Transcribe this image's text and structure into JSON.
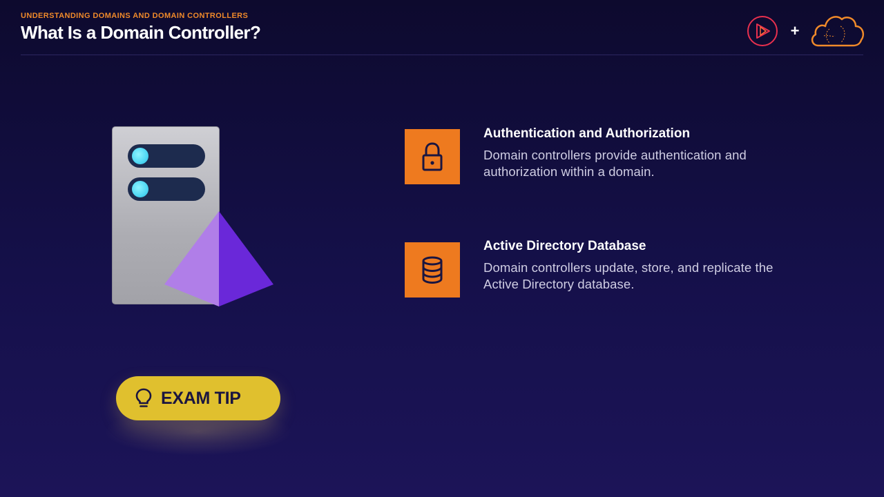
{
  "header": {
    "kicker": "UNDERSTANDING DOMAINS AND DOMAIN CONTROLLERS",
    "title": "What Is a Domain Controller?",
    "plus": "+"
  },
  "features": [
    {
      "icon": "lock-icon",
      "title": "Authentication and Authorization",
      "description": "Domain controllers provide authentication and authorization within a domain."
    },
    {
      "icon": "database-icon",
      "title": "Active Directory Database",
      "description": "Domain controllers update, store, and replicate the Active Directory database."
    }
  ],
  "exam_tip": {
    "label": "EXAM TIP",
    "icon": "lightbulb-icon"
  },
  "colors": {
    "accent_orange": "#ee7a1f",
    "tip_yellow": "#e0c02e",
    "background": "#15104a",
    "pyramid_light": "#b07ee8",
    "pyramid_dark": "#6a28d9"
  }
}
